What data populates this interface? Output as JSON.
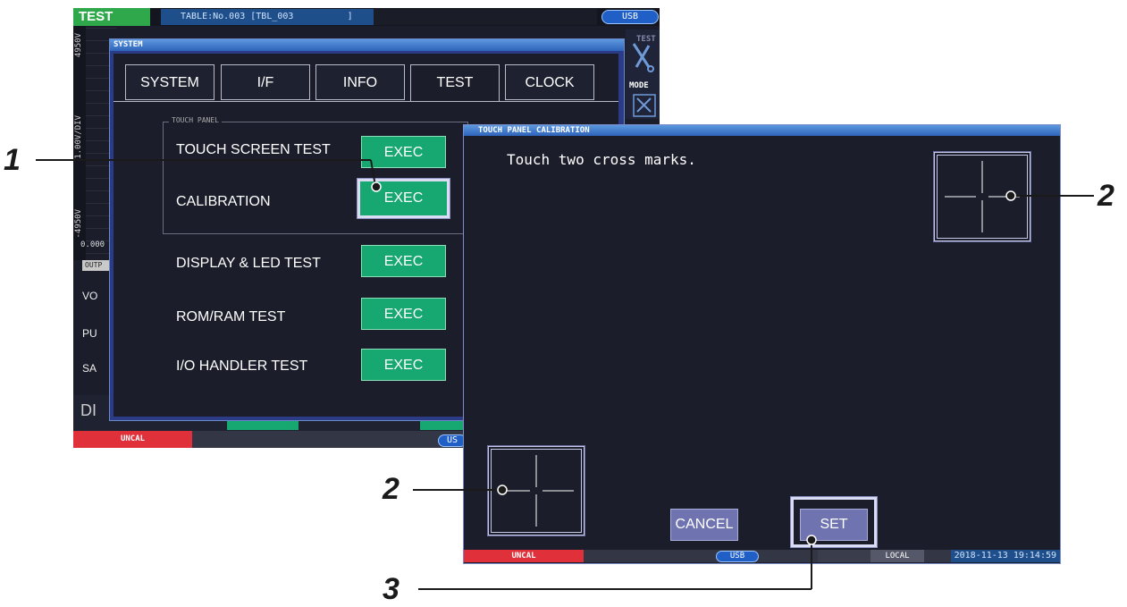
{
  "header": {
    "mode": "TEST",
    "table": "TABLE:No.003 [TBL_003          ]",
    "usb": "USB"
  },
  "left_panel": {
    "axis_labels": [
      "4950V",
      "1.00V/DIV",
      "-4950V"
    ],
    "axis_value": "0.000",
    "tab_fragment": "OUTP",
    "rows": [
      "VO",
      "PU",
      "SA"
    ],
    "bottom_fragment": "DI"
  },
  "right_panel": {
    "test_label": "TEST",
    "mode_label": "MODE"
  },
  "system_window": {
    "title": "SYSTEM",
    "tabs": [
      "SYSTEM",
      "I/F",
      "INFO",
      "TEST",
      "CLOCK"
    ],
    "active_tab": "TEST",
    "group_label": "TOUCH PANEL",
    "rows": [
      {
        "label": "TOUCH SCREEN TEST",
        "button": "EXEC"
      },
      {
        "label": "CALIBRATION",
        "button": "EXEC"
      },
      {
        "label": "DISPLAY & LED TEST",
        "button": "EXEC"
      },
      {
        "label": "ROM/RAM TEST",
        "button": "EXEC"
      },
      {
        "label": "I/O HANDLER TEST",
        "button": "EXEC"
      }
    ]
  },
  "status_bar": {
    "uncal": "UNCAL",
    "usb": "US"
  },
  "calibration_window": {
    "title": "TOUCH PANEL CALIBRATION",
    "message": "Touch two cross marks.",
    "cancel_label": "CANCEL",
    "set_label": "SET",
    "status": {
      "uncal": "UNCAL",
      "usb": "USB",
      "local": "LOCAL",
      "datetime": "2018-11-13 19:14:59"
    }
  },
  "callouts": [
    "1",
    "2",
    "2",
    "3"
  ]
}
